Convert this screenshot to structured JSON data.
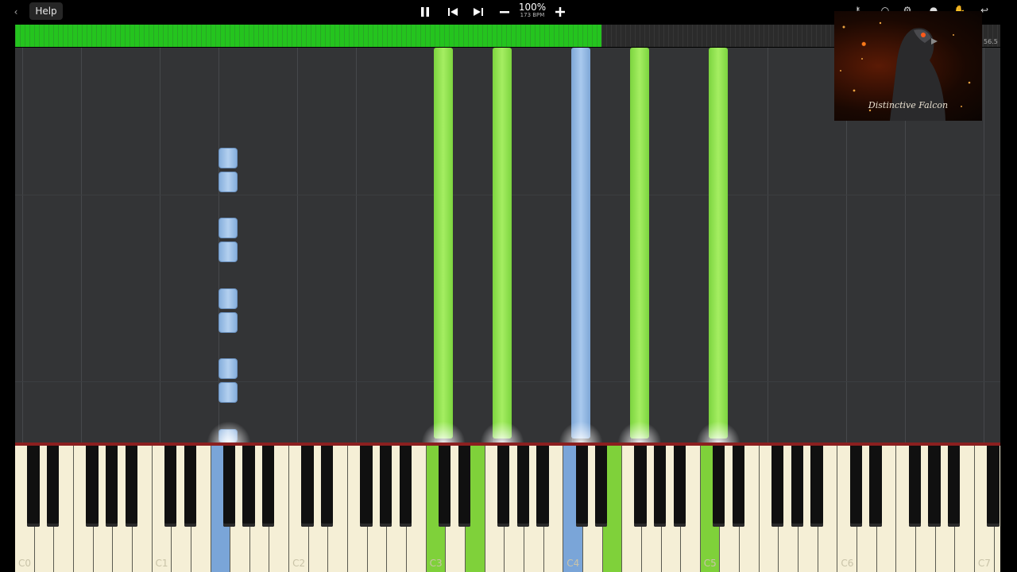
{
  "toolbar": {
    "back_icon": "chevron-left-icon",
    "help_label": "Help",
    "pause_icon": "pause-icon",
    "prev_icon": "skip-back-icon",
    "next_icon": "skip-forward-icon",
    "speed_down_icon": "minus-icon",
    "speed_up_icon": "plus-icon",
    "speed_percent": "100%",
    "tempo_bpm": "173 BPM",
    "right_icons": [
      "key-icon",
      "search-icon",
      "settings-icon",
      "user-icon",
      "hand-icon",
      "return-icon"
    ]
  },
  "timeline": {
    "progress_fraction": 0.595,
    "time_readout": "56.5",
    "progress_color": "#24c41e"
  },
  "notes": {
    "colors": {
      "right_hand": "#8ee04a",
      "left_hand": "#9bbde6"
    }
  },
  "keyboard": {
    "octave_labels": [
      "C0",
      "C1",
      "C2",
      "C3",
      "C4",
      "C5",
      "C6",
      "C7"
    ],
    "pressed_keys": [
      {
        "note": "F1",
        "hand": "left"
      },
      {
        "note": "C3",
        "hand": "right"
      },
      {
        "note": "E3",
        "hand": "right"
      },
      {
        "note": "C4",
        "hand": "left"
      },
      {
        "note": "E4",
        "hand": "right"
      },
      {
        "note": "C5",
        "hand": "right"
      }
    ]
  },
  "thumbnail": {
    "caption": "Distinctive Falcon"
  }
}
